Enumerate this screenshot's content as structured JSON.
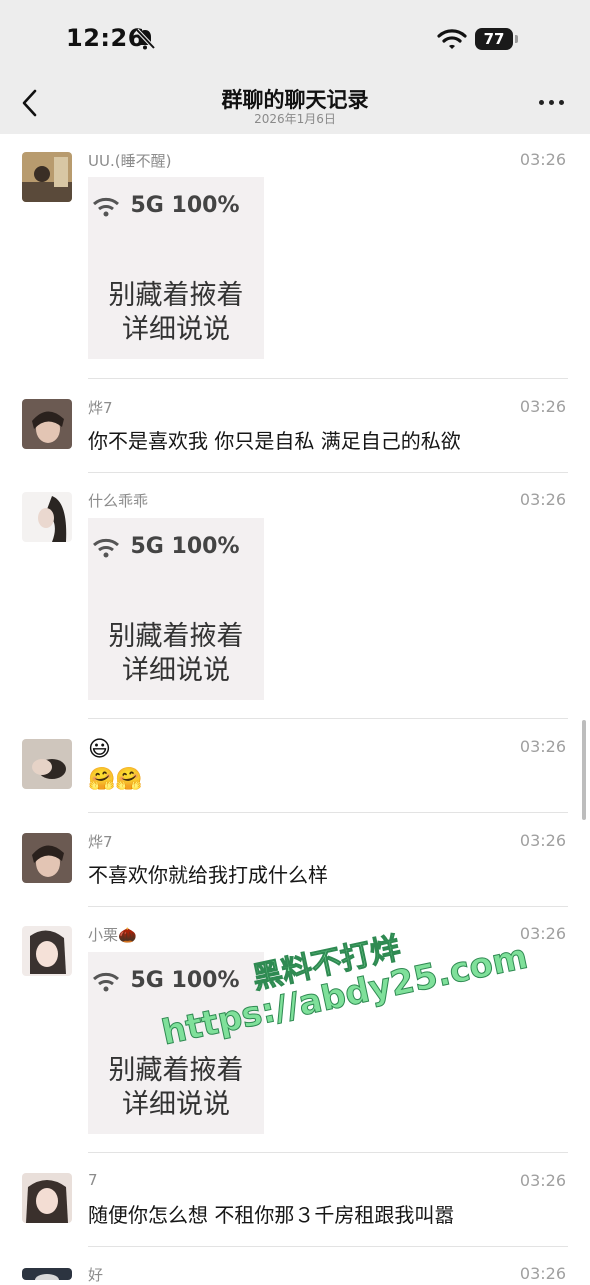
{
  "status_bar": {
    "time": "12:26",
    "battery": "77"
  },
  "header": {
    "title": "群聊的聊天记录",
    "subtitle": "2026年1月6日"
  },
  "sticker": {
    "status": "5G 100%",
    "line1": "别藏着掖着",
    "line2": "详细说说"
  },
  "messages": [
    {
      "name": "UU.(睡不醒)",
      "time": "03:26"
    },
    {
      "name": "烨7",
      "time": "03:26",
      "text": "你不是喜欢我 你只是自私 满足自己的私欲"
    },
    {
      "name": "什么乖乖",
      "time": "03:26"
    },
    {
      "name": "",
      "time": "03:26",
      "line1": "😃",
      "line2": "🤗🤗"
    },
    {
      "name": "烨7",
      "time": "03:26",
      "text": "不喜欢你就给我打成什么样"
    },
    {
      "name": "小栗🌰",
      "time": "03:26"
    },
    {
      "name": "7",
      "time": "03:26",
      "text": "随便你怎么想 不租你那３千房租跟我叫嚣"
    },
    {
      "name": "好",
      "time": "03:26"
    }
  ],
  "watermark": {
    "line1": "黑料不打烊",
    "line2": "https://abdy25.com"
  }
}
